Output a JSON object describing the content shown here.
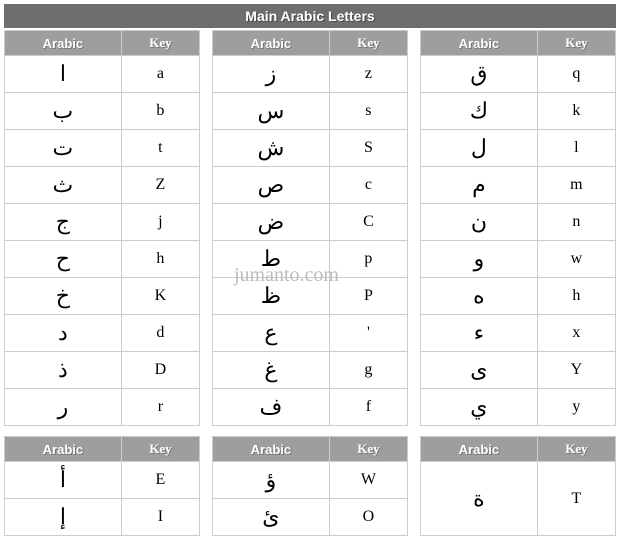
{
  "title": "Main Arabic Letters",
  "headers": {
    "arabic": "Arabic",
    "key": "Key"
  },
  "watermark": "jumanto.com",
  "mainTables": [
    [
      {
        "ar": "ا",
        "key": "a"
      },
      {
        "ar": "ب",
        "key": "b"
      },
      {
        "ar": "ت",
        "key": "t"
      },
      {
        "ar": "ث",
        "key": "Z"
      },
      {
        "ar": "ج",
        "key": "j"
      },
      {
        "ar": "ح",
        "key": "h"
      },
      {
        "ar": "خ",
        "key": "K"
      },
      {
        "ar": "د",
        "key": "d"
      },
      {
        "ar": "ذ",
        "key": "D"
      },
      {
        "ar": "ر",
        "key": "r"
      }
    ],
    [
      {
        "ar": "ز",
        "key": "z"
      },
      {
        "ar": "س",
        "key": "s"
      },
      {
        "ar": "ش",
        "key": "S"
      },
      {
        "ar": "ص",
        "key": "c"
      },
      {
        "ar": "ض",
        "key": "C"
      },
      {
        "ar": "ط",
        "key": "p"
      },
      {
        "ar": "ظ",
        "key": "P"
      },
      {
        "ar": "ع",
        "key": "'"
      },
      {
        "ar": "غ",
        "key": "g"
      },
      {
        "ar": "ف",
        "key": "f"
      }
    ],
    [
      {
        "ar": "ق",
        "key": "q"
      },
      {
        "ar": "ك",
        "key": "k"
      },
      {
        "ar": "ل",
        "key": "l"
      },
      {
        "ar": "م",
        "key": "m"
      },
      {
        "ar": "ن",
        "key": "n"
      },
      {
        "ar": "و",
        "key": "w"
      },
      {
        "ar": "ه",
        "key": "h"
      },
      {
        "ar": "ء",
        "key": "x"
      },
      {
        "ar": "ى",
        "key": "Y"
      },
      {
        "ar": "ي",
        "key": "y"
      }
    ]
  ],
  "extraTables": [
    [
      {
        "ar": "أ",
        "key": "E"
      },
      {
        "ar": "إ",
        "key": "I"
      }
    ],
    [
      {
        "ar": "ؤ",
        "key": "W"
      },
      {
        "ar": "ئ",
        "key": "O"
      }
    ],
    [
      {
        "ar": "ة",
        "key": "T"
      }
    ]
  ]
}
